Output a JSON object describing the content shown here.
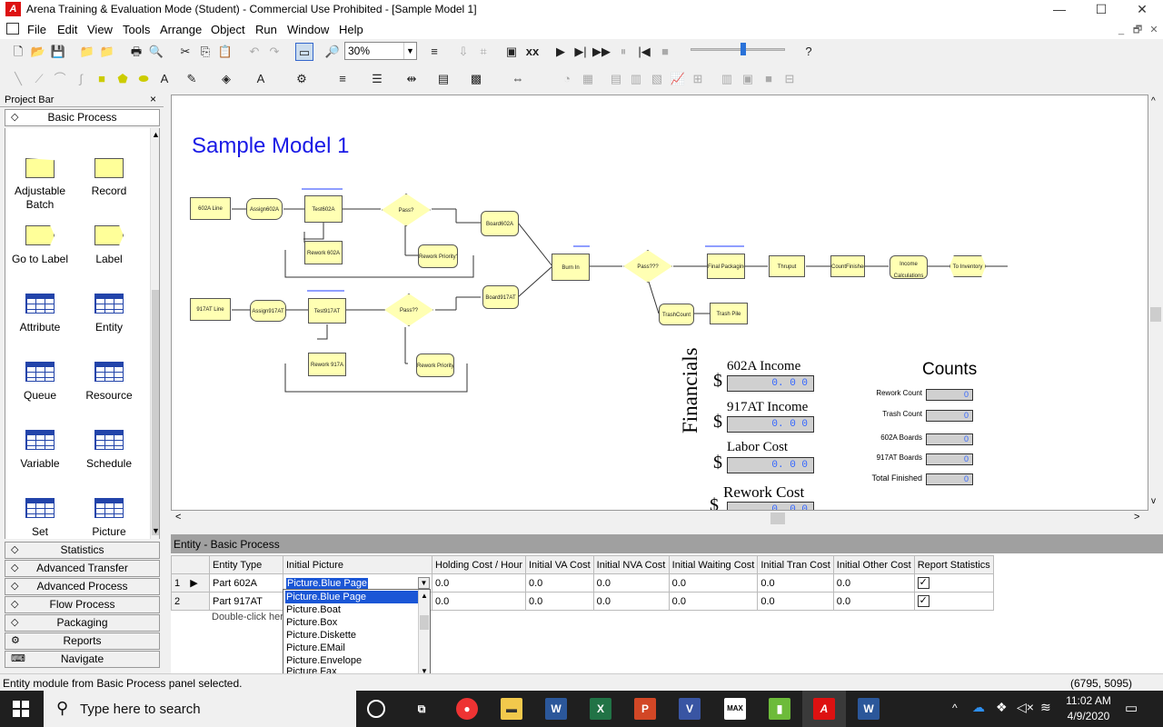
{
  "window": {
    "title": "Arena Training & Evaluation Mode (Student) - Commercial Use Prohibited - [Sample Model 1]",
    "logo_text": "A",
    "minimize": "—",
    "maximize": "☐",
    "close": "✕"
  },
  "menu": [
    "File",
    "Edit",
    "View",
    "Tools",
    "Arrange",
    "Object",
    "Run",
    "Window",
    "Help"
  ],
  "mdi_controls": [
    "_",
    "🗗",
    "✕"
  ],
  "toolbar": {
    "zoom": "30%"
  },
  "project_bar": {
    "title": "Project Bar",
    "close": "×",
    "active_panel": "Basic Process",
    "items": [
      {
        "label": "Adjustable Batch",
        "icon": "batch-shape"
      },
      {
        "label": "Record",
        "icon": "record-shape"
      },
      {
        "label": "Go to Label",
        "icon": "label-flag-shape"
      },
      {
        "label": "Label",
        "icon": "label-flag-shape"
      },
      {
        "label": "Attribute",
        "icon": "table-icon"
      },
      {
        "label": "Entity",
        "icon": "table-icon"
      },
      {
        "label": "Queue",
        "icon": "table-icon"
      },
      {
        "label": "Resource",
        "icon": "table-icon"
      },
      {
        "label": "Variable",
        "icon": "table-icon"
      },
      {
        "label": "Schedule",
        "icon": "table-icon"
      },
      {
        "label": "Set",
        "icon": "table-icon"
      },
      {
        "label": "Picture",
        "icon": "table-icon"
      }
    ],
    "panels": [
      "Statistics",
      "Advanced Transfer",
      "Advanced Process",
      "Flow Process",
      "Packaging",
      "Reports",
      "Navigate"
    ]
  },
  "canvas": {
    "title": "Sample Model 1",
    "modules": {
      "line602": "602A Line",
      "assign602": "Assign602A",
      "test602": "Test602A",
      "pass1": "Pass?",
      "board602": "Board602A",
      "rework602": "Rework 602A",
      "reworkprio1": "Rework Priority?",
      "burnin": "Burn In",
      "pass3": "Pass???",
      "finalpack": "Final Packaging",
      "thruput": "Thruput",
      "countfinished": "CountFinished",
      "income": "Income Calculations",
      "toinventory": "To Inventory",
      "trashcount": "TrashCount",
      "trashpile": "Trash Pile",
      "line917": "917AT Line",
      "assign917": "Assign917AT",
      "test917": "Test917AT",
      "pass2": "Pass??",
      "board917": "Board917AT",
      "rework917": "Rework 917A",
      "reworkprio2": "Rework Priority2"
    },
    "financials": {
      "heading": "Financials",
      "items": [
        {
          "label": "602A Income",
          "value": "0. 0 0"
        },
        {
          "label": "917AT Income",
          "value": "0. 0 0"
        },
        {
          "label": "Labor Cost",
          "value": "0. 0 0"
        },
        {
          "label": "Rework Cost",
          "value": "0. 0 0"
        }
      ],
      "currency": "$"
    },
    "counts": {
      "heading": "Counts",
      "items": [
        {
          "label": "Rework Count",
          "value": "0"
        },
        {
          "label": "Trash Count",
          "value": "0"
        },
        {
          "label": "602A Boards",
          "value": "0"
        },
        {
          "label": "917AT Boards",
          "value": "0"
        },
        {
          "label": "Total Finished",
          "value": "0"
        }
      ]
    }
  },
  "spreadsheet": {
    "title": "Entity - Basic Process",
    "columns": [
      "",
      "Entity Type",
      "Initial Picture",
      "Holding Cost / Hour",
      "Initial VA Cost",
      "Initial NVA Cost",
      "Initial Waiting Cost",
      "Initial Tran Cost",
      "Initial Other Cost",
      "Report Statistics"
    ],
    "rows": [
      {
        "num": "1",
        "type": "Part 602A",
        "picture": "Picture.Blue Page",
        "holding": "0.0",
        "va": "0.0",
        "nva": "0.0",
        "waiting": "0.0",
        "tran": "0.0",
        "other": "0.0",
        "report": "✓"
      },
      {
        "num": "2",
        "type": "Part 917AT",
        "picture": "",
        "holding": "0.0",
        "va": "0.0",
        "nva": "0.0",
        "waiting": "0.0",
        "tran": "0.0",
        "other": "0.0",
        "report": "✓"
      }
    ],
    "hint": "Double-click her",
    "dropdown": [
      "Picture.Blue Page",
      "Picture.Boat",
      "Picture.Box",
      "Picture.Diskette",
      "Picture.EMail",
      "Picture.Envelope",
      "Picture.Fax"
    ]
  },
  "status": {
    "message": "Entity module from Basic Process panel selected.",
    "coords": "(6795, 5095)"
  },
  "taskbar": {
    "search_placeholder": "Type here to search",
    "time": "11:02 AM",
    "date": "4/9/2020"
  }
}
